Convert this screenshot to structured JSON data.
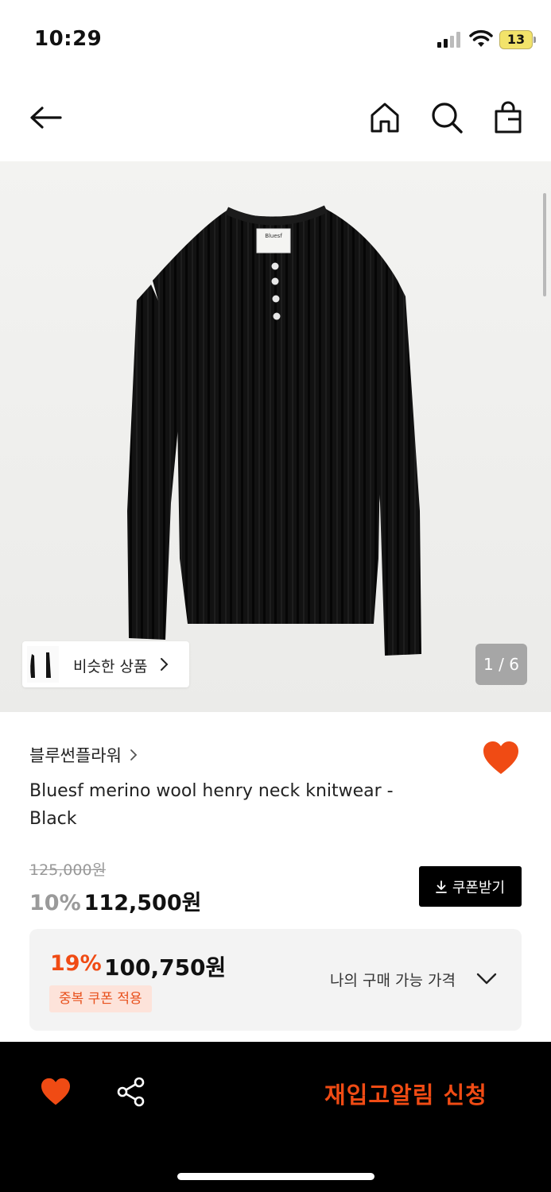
{
  "status": {
    "time": "10:29",
    "battery": "13"
  },
  "nav": {
    "back_icon": "arrow-left-icon",
    "home_icon": "home-icon",
    "search_icon": "search-icon",
    "bag_icon": "shopping-bag-icon"
  },
  "hero": {
    "similar_label": "비슷한 상품",
    "counter": "1 / 6"
  },
  "product": {
    "brand": "블루썬플라워",
    "title": "Bluesf merino wool henry neck knitwear - Black",
    "original_price": "125,000원",
    "discount_pct": "10%",
    "price": "112,500원",
    "coupon_label": "쿠폰받기"
  },
  "best_price": {
    "pct": "19%",
    "price": "100,750원",
    "tag": "중복 쿠폰 적용",
    "toggle_label": "나의 구매 가능 가격"
  },
  "bottom": {
    "restock_label": "재입고알림 신청"
  },
  "colors": {
    "accent": "#f04b14",
    "black": "#000000"
  }
}
